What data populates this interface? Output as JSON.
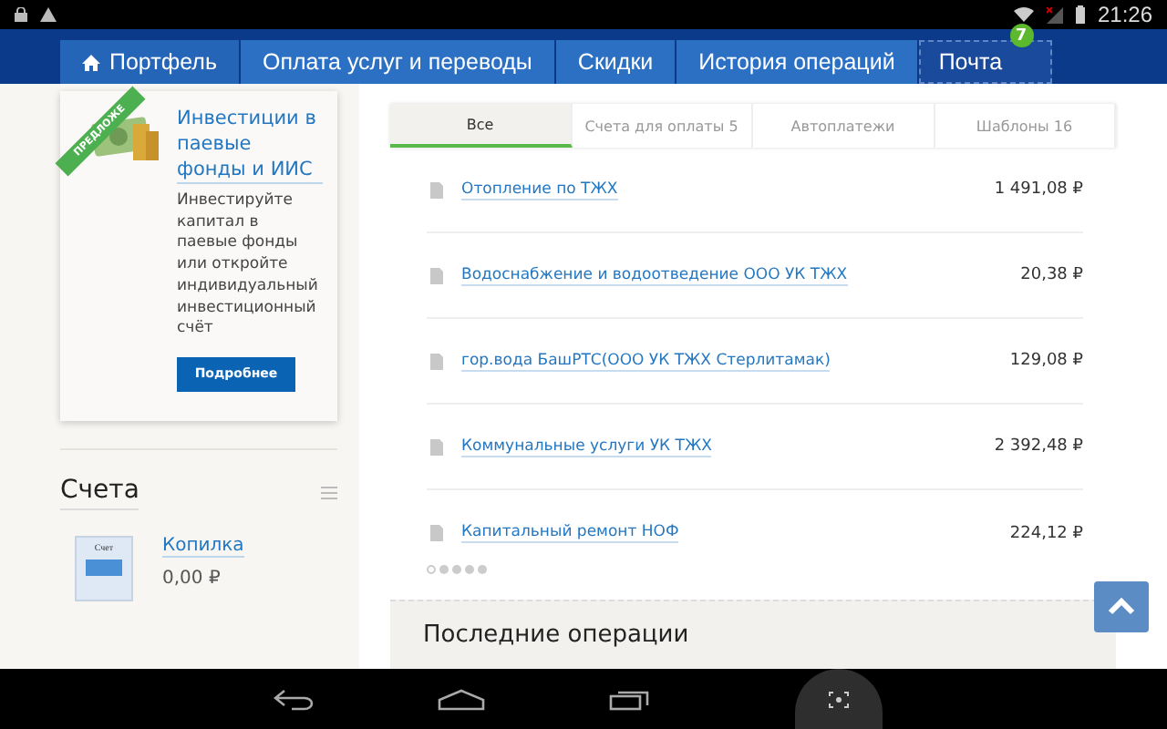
{
  "status_bar": {
    "time": "21:26"
  },
  "nav_tabs": [
    {
      "label": "Портфель",
      "selected": true,
      "kind": "home"
    },
    {
      "label": "Оплата услуг и переводы",
      "selected": false,
      "kind": "plain"
    },
    {
      "label": "Скидки",
      "selected": false,
      "kind": "plain"
    },
    {
      "label": "История операций",
      "selected": false,
      "kind": "plain"
    },
    {
      "label": "Почта",
      "selected": false,
      "kind": "mail",
      "badge": "7"
    }
  ],
  "promo": {
    "ribbon": "ПРЕДЛОЖЕ",
    "title": "Инвестиции в паевые фонды и ИИС",
    "text": "Инвестируйте капитал в паевые фонды или откройте индивидуальный инвестиционный счёт",
    "button": "Подробнее"
  },
  "accounts": {
    "title": "Счета",
    "items": [
      {
        "icon_label": "Счет",
        "name": "Копилка",
        "amount": "0,00 ₽"
      }
    ]
  },
  "payment_tabs": [
    {
      "label": "Все",
      "selected": true
    },
    {
      "label": "Счета для оплаты 5",
      "selected": false
    },
    {
      "label": "Автоплатежи",
      "selected": false
    },
    {
      "label": "Шаблоны 16",
      "selected": false
    }
  ],
  "payments": [
    {
      "name": "Отопление по ТЖХ",
      "amount": "1 491,08 ₽"
    },
    {
      "name": "Водоснабжение и водоотведение ООО УК ТЖХ",
      "amount": "20,38 ₽"
    },
    {
      "name": "гор.вода БашРТС(ООО УК ТЖХ Стерлитамак)",
      "amount": "129,08 ₽"
    },
    {
      "name": "Коммунальные услуги УК ТЖХ",
      "amount": "2 392,48 ₽"
    },
    {
      "name": "Капитальный ремонт НОФ",
      "amount": "224,12 ₽"
    }
  ],
  "pager": [
    {
      "selected": true
    },
    {
      "selected": false
    },
    {
      "selected": false
    },
    {
      "selected": false
    },
    {
      "selected": false
    }
  ],
  "recent": {
    "title": "Последние операции"
  }
}
